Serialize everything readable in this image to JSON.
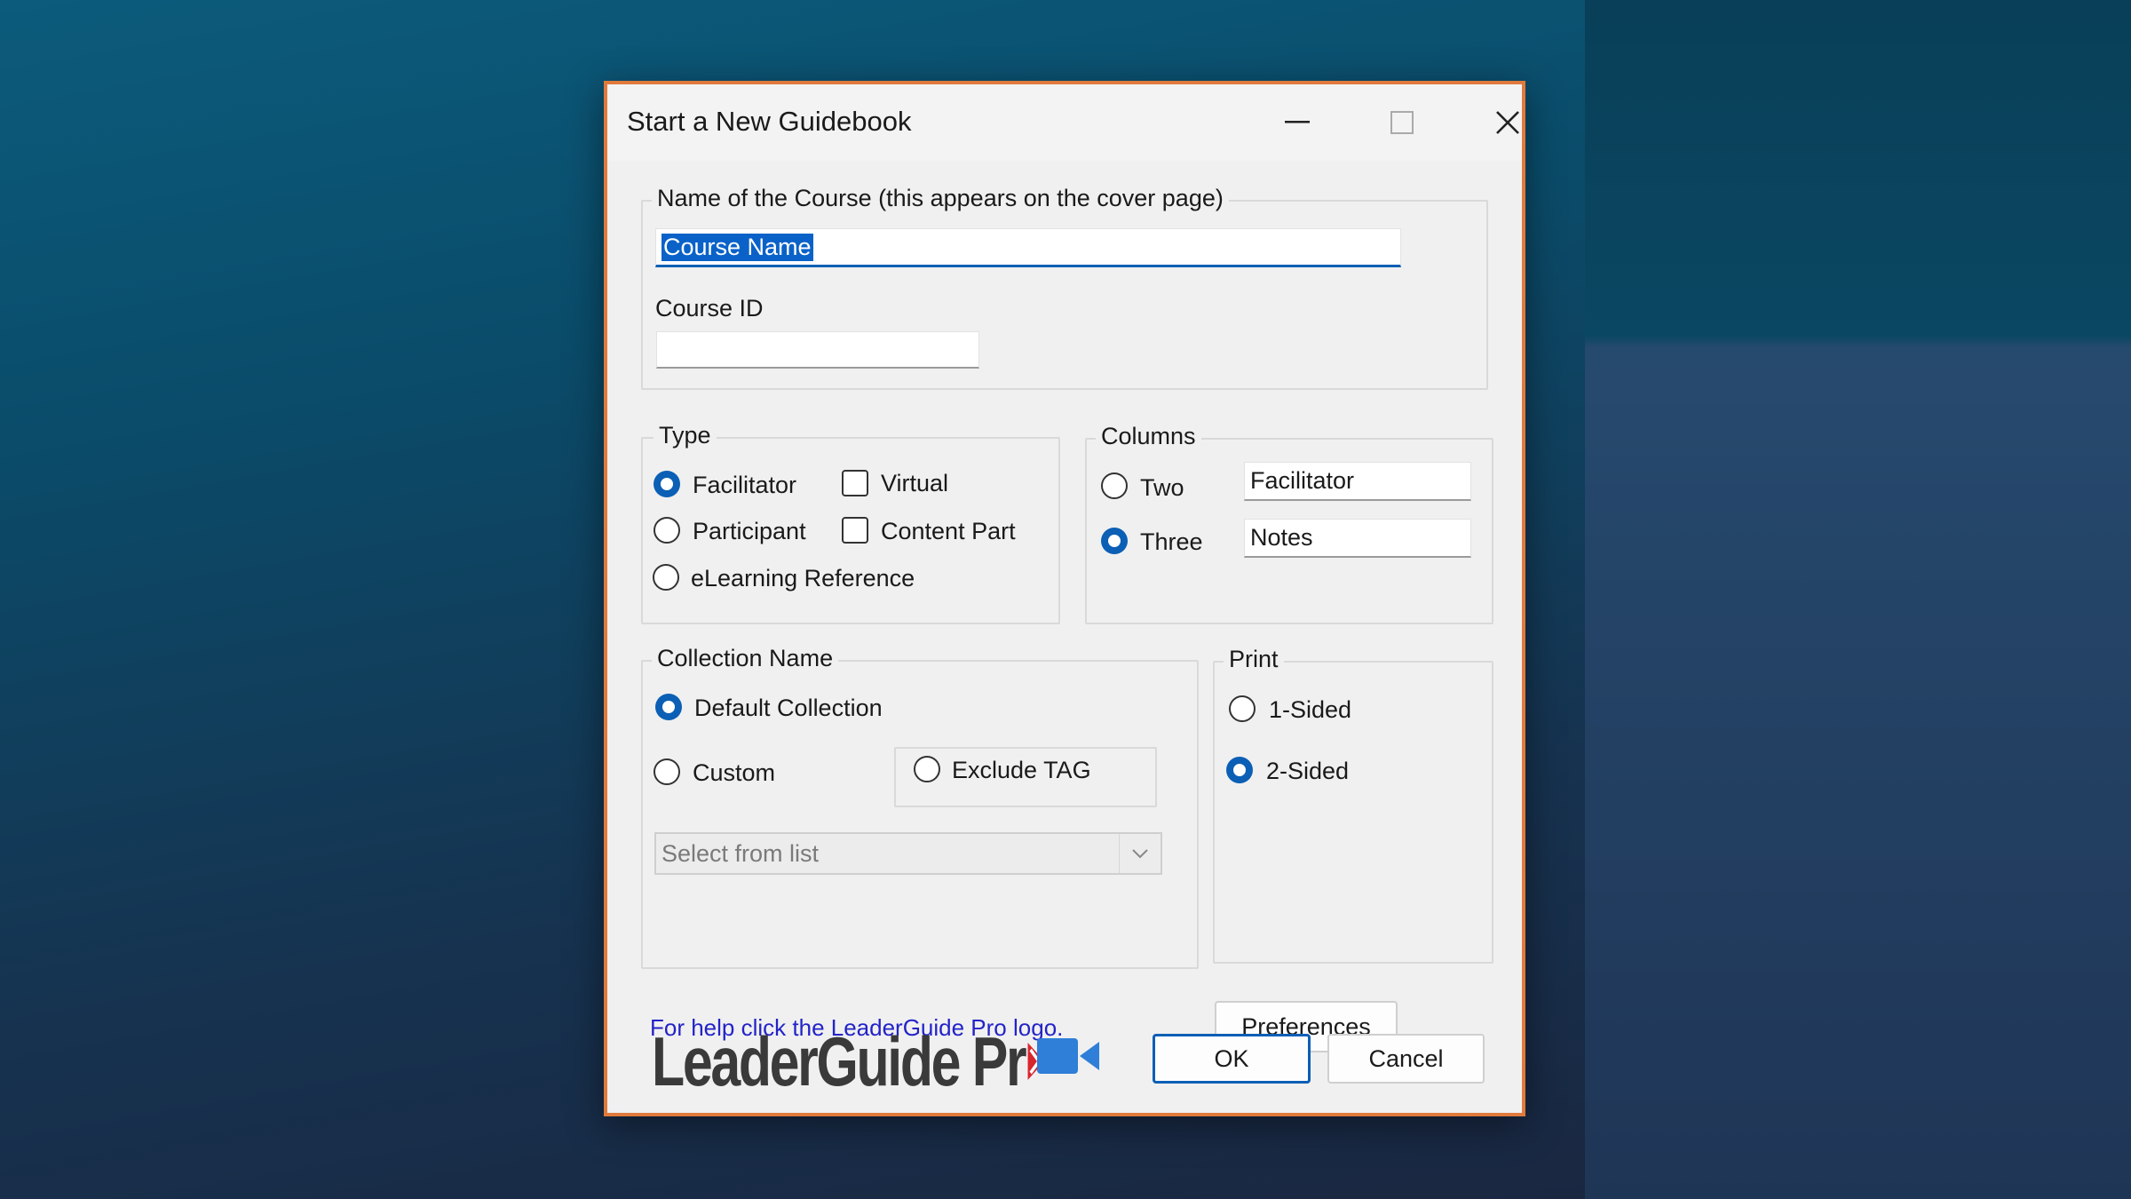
{
  "window": {
    "title": "Start a New Guidebook",
    "minimize": "minimize",
    "maximize": "maximize",
    "close": "close"
  },
  "course": {
    "group_label": "Name of the Course (this appears on the cover page)",
    "name_value": "Course Name",
    "id_label": "Course ID",
    "id_value": ""
  },
  "type": {
    "group_label": "Type",
    "facilitator": "Facilitator",
    "participant": "Participant",
    "elearning": "eLearning Reference",
    "virtual": "Virtual",
    "content_part": "Content Part",
    "selected": "Facilitator"
  },
  "columns": {
    "group_label": "Columns",
    "two": "Two",
    "three": "Three",
    "selected": "Three",
    "col2_value": "Facilitator",
    "col3_value": "Notes"
  },
  "collection": {
    "group_label": "Collection Name",
    "default": "Default Collection",
    "custom": "Custom",
    "exclude_tag": "Exclude TAG",
    "select_placeholder": "Select from list",
    "selected": "Default Collection"
  },
  "print": {
    "group_label": "Print",
    "one_sided": "1-Sided",
    "two_sided": "2-Sided",
    "selected": "2-Sided"
  },
  "help_link": "For help click the LeaderGuide Pro logo.",
  "buttons": {
    "preferences": "Preferences",
    "ok": "OK",
    "cancel": "Cancel"
  },
  "logo": {
    "text": "LeaderGuide Pr",
    "colors": {
      "text": "#3a3a3a",
      "accent": "#d9262c"
    }
  },
  "icons": {
    "video": "video-camera-icon"
  },
  "colors": {
    "accent": "#0b5fb5",
    "dialog_border": "#e07a3c",
    "link": "#2323c8"
  }
}
